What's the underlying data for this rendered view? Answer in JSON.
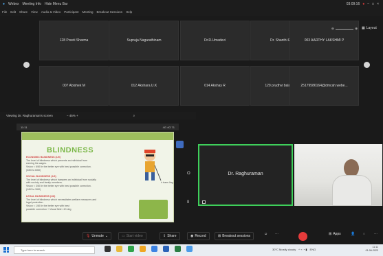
{
  "window": {
    "title_items": [
      "Webex",
      "Meeting Info",
      "Hide Menu Bar"
    ],
    "clock": "03:09:16",
    "layout_label": "Layout"
  },
  "menu": [
    "File",
    "Edit",
    "Share",
    "View",
    "Audio & Video",
    "Participant",
    "Meeting",
    "Breakout Sessions",
    "Help"
  ],
  "participants": [
    {
      "name": "128 Preeti Sharma"
    },
    {
      "name": "Supraja Nagarathinam"
    },
    {
      "name": "Dr.R.Umadevi"
    },
    {
      "name": "Dr. Shanthi Edward"
    },
    {
      "name": "003 AARTHY LAKSHMI P"
    },
    {
      "name": "007 Abishek M"
    },
    {
      "name": "012 Akshara.U.K"
    },
    {
      "name": "014 Akshay R"
    },
    {
      "name": "129 prudhvi balaji 8th sem"
    },
    {
      "name": "25179586164@dmcah.webe..."
    }
  ],
  "share": {
    "viewing_label": "Viewing Dr. Raghuraman's screen",
    "zoom": "45%",
    "phone_time": "11:11",
    "phone_status": "4G 4G 71"
  },
  "slide": {
    "title": "BLINDNESS",
    "items": [
      {
        "heading": "ECONOMIC BLINDNESS (1/5)",
        "text": [
          "The level of blindness which prevents an individual from",
          "earning his wages.",
          "Vision < 6/60 in the better eye with best possible correction.",
          "(3/60 to 6/60)"
        ]
      },
      {
        "heading": "SOCIAL BLINDNESS (1/6)",
        "text": [
          "The level of blindness which hampers an individual from socially",
          "with society and family members.",
          "Vision < 3/60 in the better eye with best possible correction.",
          "(1/60 to 3/60)"
        ]
      },
      {
        "heading": "LEGAL BLINDNESS (1/8)",
        "text": [
          "The level of blindness which necessitates welfare measures and",
          "legal protection.",
          "Vision < 1/60 in the better eye with best",
          "possible correction + Visual field <10 deg"
        ]
      }
    ],
    "caption": "ir trans ling"
  },
  "speaker": {
    "name": "Dr. Raghuraman"
  },
  "toolbar": {
    "unmute": "Unmute",
    "start_video": "Start video",
    "share": "Share",
    "record": "Record",
    "breakout": "Breakout sessions",
    "apps": "Apps"
  },
  "taskbar": {
    "search_placeholder": "Type here to search",
    "weather": "30°C Mostly cloudy",
    "lang": "ENG",
    "time": "11:11",
    "date": "01-06-2023"
  },
  "colors": {
    "accent_green": "#3ecf5a",
    "end_red": "#e53b3b",
    "slide_title": "#7cb84a"
  }
}
